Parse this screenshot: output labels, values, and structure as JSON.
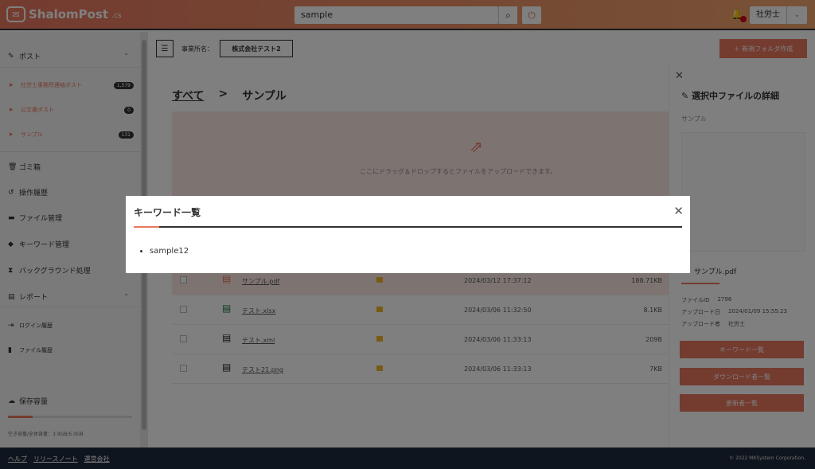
{
  "header": {
    "logo_text": "ShalomPost",
    "logo_suffix": ".cs",
    "search_value": "sample",
    "user_name": "社労士"
  },
  "sidebar": {
    "post_section": "ポスト",
    "post_items": [
      {
        "label": "社労士事務所連絡ポスト",
        "badge": "1,579"
      },
      {
        "label": "公文書ポスト",
        "badge": "0"
      },
      {
        "label": "サンプル",
        "badge": "131"
      }
    ],
    "items": [
      "ゴミ箱",
      "操作履歴",
      "ファイル管理",
      "キーワード管理",
      "バックグラウンド処理"
    ],
    "report_section": "レポート",
    "report_items": [
      "ログイン履歴",
      "ファイル履歴"
    ],
    "storage_label": "保存容量",
    "storage_text": "空き容量/全体容量：3.9GB/5.0GB"
  },
  "toolbar": {
    "office_label": "事業所名：",
    "office_value": "株式会社テスト2",
    "new_folder": "＋ 新規フォルダ作成"
  },
  "breadcrumb": {
    "root": "すべて",
    "sep": ">",
    "current": "サンプル"
  },
  "dropzone_text": "ここにドラッグ＆ドロップするとファイルをアップロードできます。",
  "files": [
    {
      "name": "サンプル.pdf",
      "date": "2024/03/12 17:37:12",
      "size": "188.71KB",
      "icon": "pdf"
    },
    {
      "name": "テスト.xlsx",
      "date": "2024/03/06 11:32:50",
      "size": "8.1KB",
      "icon": "xlsx"
    },
    {
      "name": "テスト.xml",
      "date": "2024/03/06 11:33:13",
      "size": "209B",
      "icon": "xml"
    },
    {
      "name": "テスト21.png",
      "date": "2024/03/06 11:33:13",
      "size": "7KB",
      "icon": "png"
    }
  ],
  "right_panel": {
    "title": "選択中ファイルの詳細",
    "folder": "サンプル",
    "file_name": "サンプル.pdf",
    "file_id_label": "ファイルID",
    "file_id": "2796",
    "upload_date_label": "アップロード日",
    "upload_date": "2024/01/09 15:55:23",
    "uploader_label": "アップロード者",
    "uploader": "社労士",
    "btn_keywords": "キーワード一覧",
    "btn_downloaders": "ダウンロード者一覧",
    "btn_updaters": "更新者一覧"
  },
  "footer": {
    "help": "ヘルプ",
    "release_notes": "リリースノート",
    "company": "運営会社",
    "copyright": "© 2022 MKSystem Corporation."
  },
  "modal": {
    "title": "キーワード一覧",
    "keywords": [
      "sample12"
    ]
  },
  "colors": {
    "accent": "#e8775f",
    "footer_bg": "#1f2a3c"
  }
}
